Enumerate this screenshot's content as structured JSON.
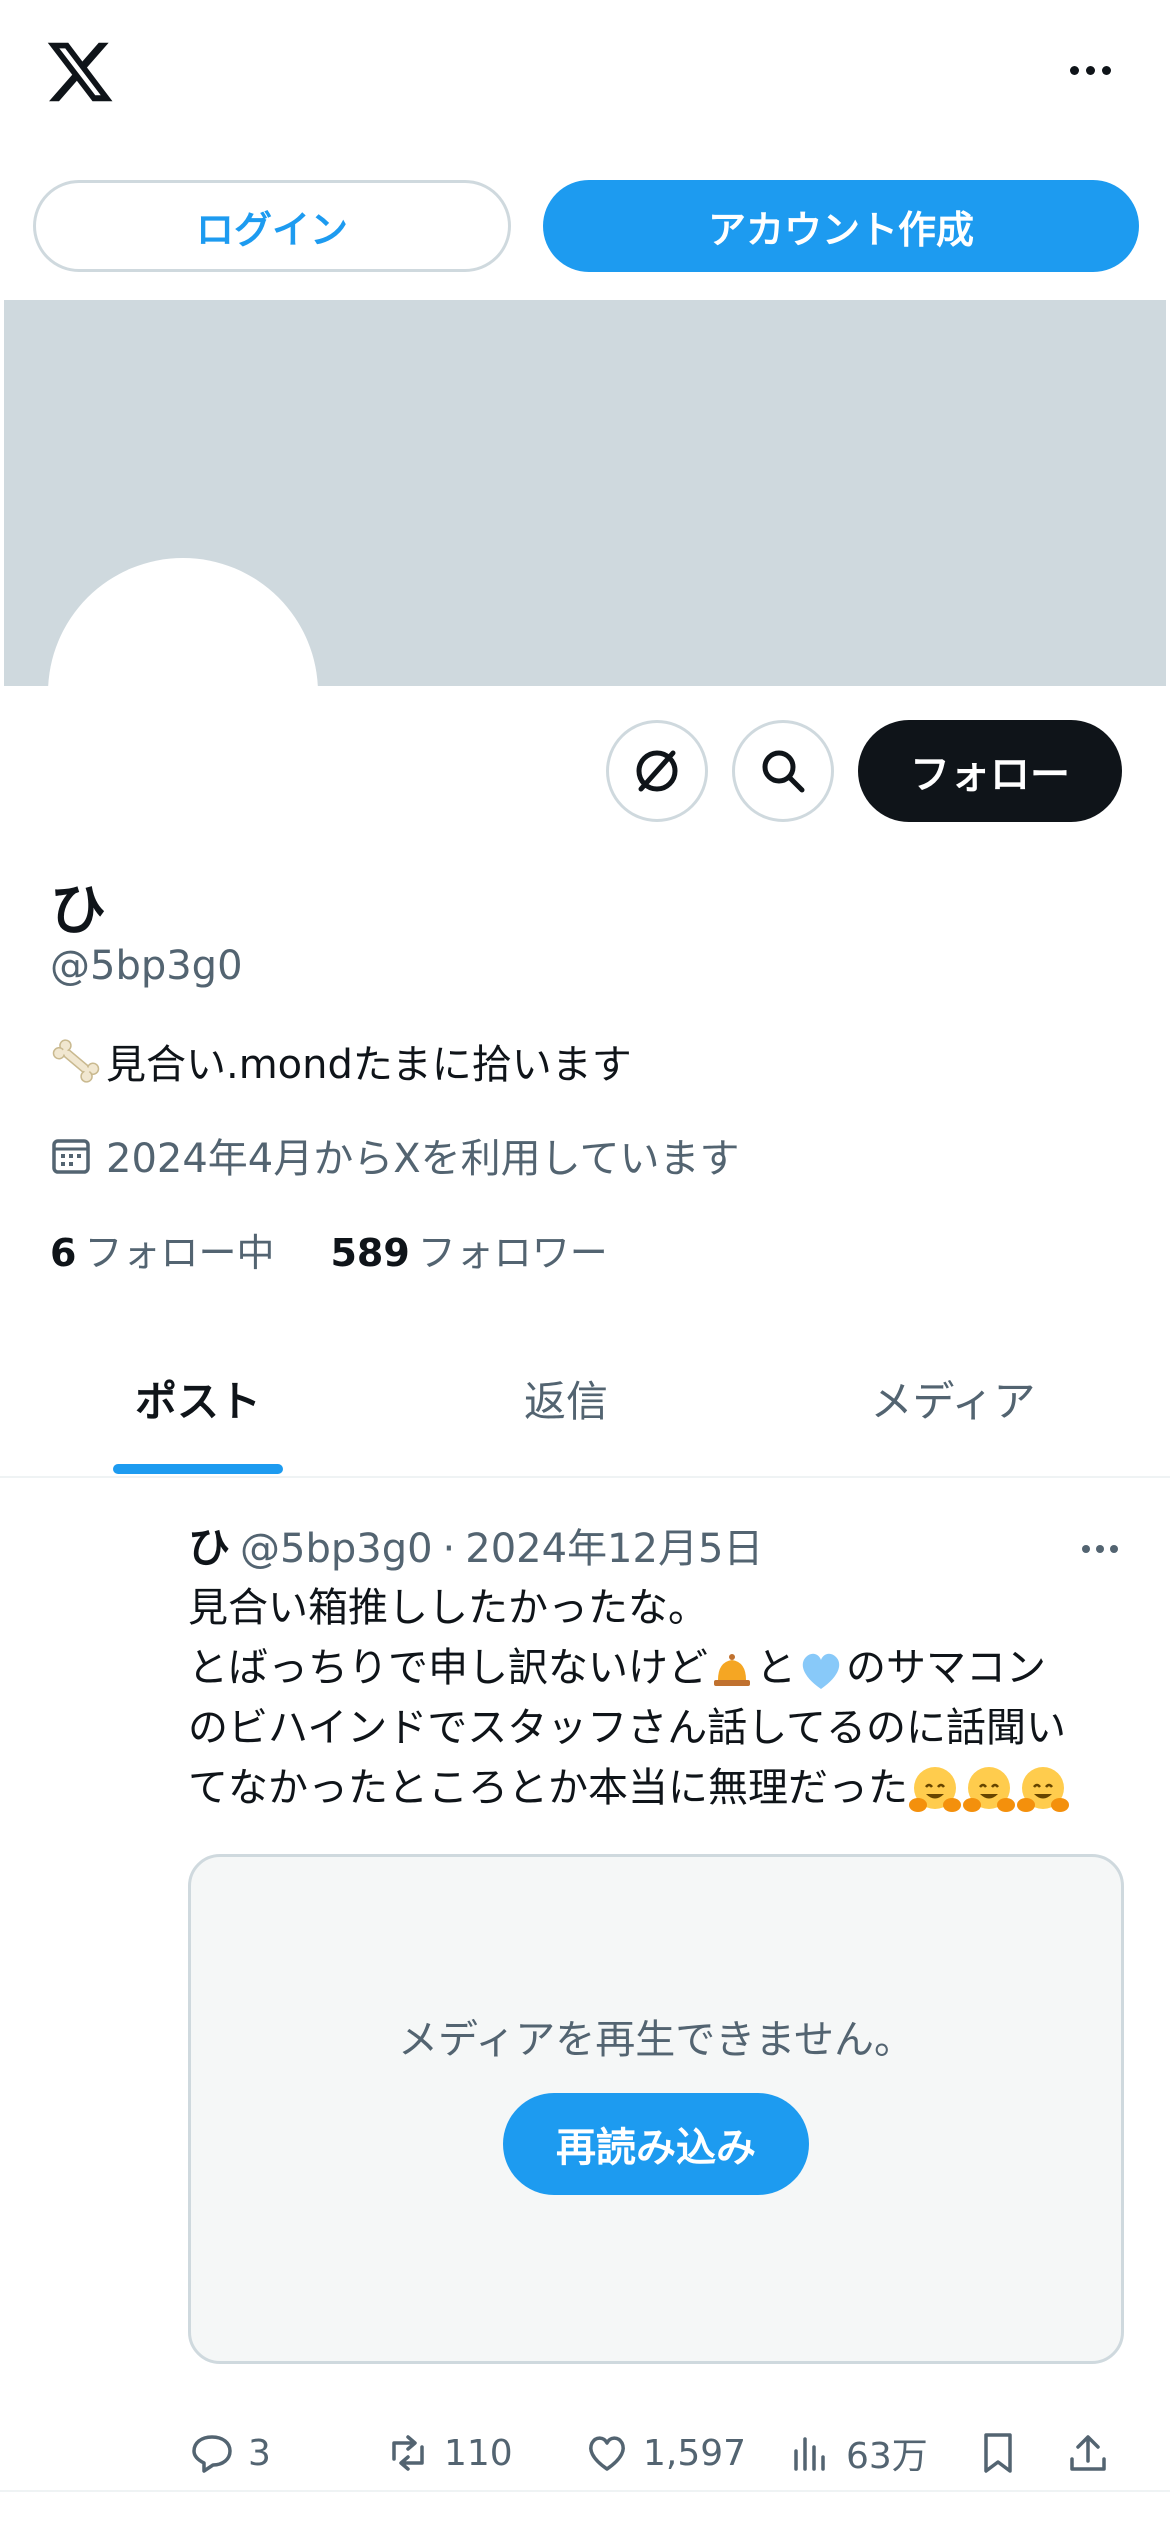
{
  "header": {
    "more_label": "more"
  },
  "auth": {
    "login_label": "ログイン",
    "signup_label": "アカウント作成"
  },
  "profile": {
    "display_name": "ひ",
    "handle": "@5bp3g0",
    "bio_emoji": "bone",
    "bio": "見合い.mondたまに拾います",
    "joined": "2024年4月からXを利用しています",
    "following_count": "6",
    "following_label": "フォロー中",
    "followers_count": "589",
    "followers_label": "フォロワー",
    "follow_button": "フォロー"
  },
  "tabs": [
    {
      "label": "ポスト",
      "active": true
    },
    {
      "label": "返信",
      "active": false
    },
    {
      "label": "メディア",
      "active": false
    }
  ],
  "post": {
    "author_name": "ひ",
    "author_handle": "@5bp3g0",
    "separator": "·",
    "date": "2024年12月5日",
    "lines": [
      "見合い箱推ししたかったな。",
      "とばっちりで申し訳ないけど",
      "と",
      "のサマコン",
      "のビハインドでスタッフさん話してるのに話聞い",
      "てなかったところとか本当に無理だった"
    ],
    "media_error": "メディアを再生できません。",
    "reload_label": "再読み込み",
    "replies": "3",
    "reposts": "110",
    "likes": "1,597",
    "views": "63万"
  },
  "colors": {
    "accent": "#1d9bf0",
    "text": "#0f1419",
    "secondary_text": "#536471",
    "banner": "#cfd9de",
    "border": "#cfd9de"
  }
}
